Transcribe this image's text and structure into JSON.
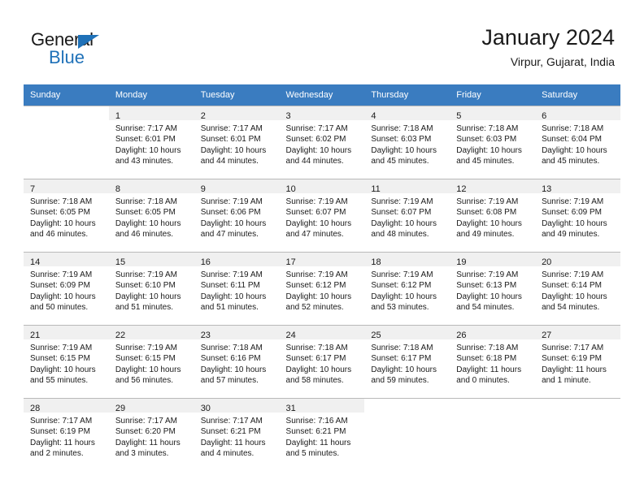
{
  "brand": {
    "name_top": "General",
    "name_bottom": "Blue",
    "accent_color": "#1f71b8"
  },
  "header": {
    "title": "January 2024",
    "subtitle": "Virpur, Gujarat, India"
  },
  "theme": {
    "header_row_bg": "#3a7cc0",
    "daynum_band_bg": "#f0f0f0",
    "grid_line": "#b9b9b9",
    "text": "#1a1a1a"
  },
  "weekday_headers": [
    "Sunday",
    "Monday",
    "Tuesday",
    "Wednesday",
    "Thursday",
    "Friday",
    "Saturday"
  ],
  "weeks": [
    [
      {
        "day": "",
        "sunrise": "",
        "sunset": "",
        "daylight_line1": "",
        "daylight_line2": ""
      },
      {
        "day": "1",
        "sunrise": "Sunrise: 7:17 AM",
        "sunset": "Sunset: 6:01 PM",
        "daylight_line1": "Daylight: 10 hours",
        "daylight_line2": "and 43 minutes."
      },
      {
        "day": "2",
        "sunrise": "Sunrise: 7:17 AM",
        "sunset": "Sunset: 6:01 PM",
        "daylight_line1": "Daylight: 10 hours",
        "daylight_line2": "and 44 minutes."
      },
      {
        "day": "3",
        "sunrise": "Sunrise: 7:17 AM",
        "sunset": "Sunset: 6:02 PM",
        "daylight_line1": "Daylight: 10 hours",
        "daylight_line2": "and 44 minutes."
      },
      {
        "day": "4",
        "sunrise": "Sunrise: 7:18 AM",
        "sunset": "Sunset: 6:03 PM",
        "daylight_line1": "Daylight: 10 hours",
        "daylight_line2": "and 45 minutes."
      },
      {
        "day": "5",
        "sunrise": "Sunrise: 7:18 AM",
        "sunset": "Sunset: 6:03 PM",
        "daylight_line1": "Daylight: 10 hours",
        "daylight_line2": "and 45 minutes."
      },
      {
        "day": "6",
        "sunrise": "Sunrise: 7:18 AM",
        "sunset": "Sunset: 6:04 PM",
        "daylight_line1": "Daylight: 10 hours",
        "daylight_line2": "and 45 minutes."
      }
    ],
    [
      {
        "day": "7",
        "sunrise": "Sunrise: 7:18 AM",
        "sunset": "Sunset: 6:05 PM",
        "daylight_line1": "Daylight: 10 hours",
        "daylight_line2": "and 46 minutes."
      },
      {
        "day": "8",
        "sunrise": "Sunrise: 7:18 AM",
        "sunset": "Sunset: 6:05 PM",
        "daylight_line1": "Daylight: 10 hours",
        "daylight_line2": "and 46 minutes."
      },
      {
        "day": "9",
        "sunrise": "Sunrise: 7:19 AM",
        "sunset": "Sunset: 6:06 PM",
        "daylight_line1": "Daylight: 10 hours",
        "daylight_line2": "and 47 minutes."
      },
      {
        "day": "10",
        "sunrise": "Sunrise: 7:19 AM",
        "sunset": "Sunset: 6:07 PM",
        "daylight_line1": "Daylight: 10 hours",
        "daylight_line2": "and 47 minutes."
      },
      {
        "day": "11",
        "sunrise": "Sunrise: 7:19 AM",
        "sunset": "Sunset: 6:07 PM",
        "daylight_line1": "Daylight: 10 hours",
        "daylight_line2": "and 48 minutes."
      },
      {
        "day": "12",
        "sunrise": "Sunrise: 7:19 AM",
        "sunset": "Sunset: 6:08 PM",
        "daylight_line1": "Daylight: 10 hours",
        "daylight_line2": "and 49 minutes."
      },
      {
        "day": "13",
        "sunrise": "Sunrise: 7:19 AM",
        "sunset": "Sunset: 6:09 PM",
        "daylight_line1": "Daylight: 10 hours",
        "daylight_line2": "and 49 minutes."
      }
    ],
    [
      {
        "day": "14",
        "sunrise": "Sunrise: 7:19 AM",
        "sunset": "Sunset: 6:09 PM",
        "daylight_line1": "Daylight: 10 hours",
        "daylight_line2": "and 50 minutes."
      },
      {
        "day": "15",
        "sunrise": "Sunrise: 7:19 AM",
        "sunset": "Sunset: 6:10 PM",
        "daylight_line1": "Daylight: 10 hours",
        "daylight_line2": "and 51 minutes."
      },
      {
        "day": "16",
        "sunrise": "Sunrise: 7:19 AM",
        "sunset": "Sunset: 6:11 PM",
        "daylight_line1": "Daylight: 10 hours",
        "daylight_line2": "and 51 minutes."
      },
      {
        "day": "17",
        "sunrise": "Sunrise: 7:19 AM",
        "sunset": "Sunset: 6:12 PM",
        "daylight_line1": "Daylight: 10 hours",
        "daylight_line2": "and 52 minutes."
      },
      {
        "day": "18",
        "sunrise": "Sunrise: 7:19 AM",
        "sunset": "Sunset: 6:12 PM",
        "daylight_line1": "Daylight: 10 hours",
        "daylight_line2": "and 53 minutes."
      },
      {
        "day": "19",
        "sunrise": "Sunrise: 7:19 AM",
        "sunset": "Sunset: 6:13 PM",
        "daylight_line1": "Daylight: 10 hours",
        "daylight_line2": "and 54 minutes."
      },
      {
        "day": "20",
        "sunrise": "Sunrise: 7:19 AM",
        "sunset": "Sunset: 6:14 PM",
        "daylight_line1": "Daylight: 10 hours",
        "daylight_line2": "and 54 minutes."
      }
    ],
    [
      {
        "day": "21",
        "sunrise": "Sunrise: 7:19 AM",
        "sunset": "Sunset: 6:15 PM",
        "daylight_line1": "Daylight: 10 hours",
        "daylight_line2": "and 55 minutes."
      },
      {
        "day": "22",
        "sunrise": "Sunrise: 7:19 AM",
        "sunset": "Sunset: 6:15 PM",
        "daylight_line1": "Daylight: 10 hours",
        "daylight_line2": "and 56 minutes."
      },
      {
        "day": "23",
        "sunrise": "Sunrise: 7:18 AM",
        "sunset": "Sunset: 6:16 PM",
        "daylight_line1": "Daylight: 10 hours",
        "daylight_line2": "and 57 minutes."
      },
      {
        "day": "24",
        "sunrise": "Sunrise: 7:18 AM",
        "sunset": "Sunset: 6:17 PM",
        "daylight_line1": "Daylight: 10 hours",
        "daylight_line2": "and 58 minutes."
      },
      {
        "day": "25",
        "sunrise": "Sunrise: 7:18 AM",
        "sunset": "Sunset: 6:17 PM",
        "daylight_line1": "Daylight: 10 hours",
        "daylight_line2": "and 59 minutes."
      },
      {
        "day": "26",
        "sunrise": "Sunrise: 7:18 AM",
        "sunset": "Sunset: 6:18 PM",
        "daylight_line1": "Daylight: 11 hours",
        "daylight_line2": "and 0 minutes."
      },
      {
        "day": "27",
        "sunrise": "Sunrise: 7:17 AM",
        "sunset": "Sunset: 6:19 PM",
        "daylight_line1": "Daylight: 11 hours",
        "daylight_line2": "and 1 minute."
      }
    ],
    [
      {
        "day": "28",
        "sunrise": "Sunrise: 7:17 AM",
        "sunset": "Sunset: 6:19 PM",
        "daylight_line1": "Daylight: 11 hours",
        "daylight_line2": "and 2 minutes."
      },
      {
        "day": "29",
        "sunrise": "Sunrise: 7:17 AM",
        "sunset": "Sunset: 6:20 PM",
        "daylight_line1": "Daylight: 11 hours",
        "daylight_line2": "and 3 minutes."
      },
      {
        "day": "30",
        "sunrise": "Sunrise: 7:17 AM",
        "sunset": "Sunset: 6:21 PM",
        "daylight_line1": "Daylight: 11 hours",
        "daylight_line2": "and 4 minutes."
      },
      {
        "day": "31",
        "sunrise": "Sunrise: 7:16 AM",
        "sunset": "Sunset: 6:21 PM",
        "daylight_line1": "Daylight: 11 hours",
        "daylight_line2": "and 5 minutes."
      },
      {
        "day": "",
        "sunrise": "",
        "sunset": "",
        "daylight_line1": "",
        "daylight_line2": ""
      },
      {
        "day": "",
        "sunrise": "",
        "sunset": "",
        "daylight_line1": "",
        "daylight_line2": ""
      },
      {
        "day": "",
        "sunrise": "",
        "sunset": "",
        "daylight_line1": "",
        "daylight_line2": ""
      }
    ]
  ]
}
